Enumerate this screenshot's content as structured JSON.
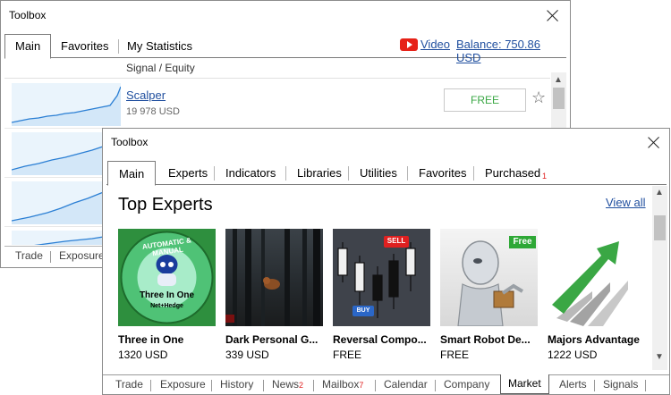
{
  "back_window": {
    "title": "Toolbox",
    "tabs": [
      "Main",
      "Favorites",
      "My Statistics"
    ],
    "video_label": "Video",
    "balance_label": "Balance: 750.86 USD",
    "column_header": "Signal / Equity",
    "signal": {
      "name": "Scalper",
      "amount": "19 978 USD",
      "action_label": "FREE"
    },
    "bottom_tabs": [
      "Trade",
      "Exposure"
    ]
  },
  "front_window": {
    "title": "Toolbox",
    "tabs": [
      {
        "label": "Main"
      },
      {
        "label": "Experts"
      },
      {
        "label": "Indicators"
      },
      {
        "label": "Libraries"
      },
      {
        "label": "Utilities"
      },
      {
        "label": "Favorites"
      },
      {
        "label": "Purchased",
        "badge": "1"
      }
    ],
    "section_title": "Top Experts",
    "view_all_label": "View all",
    "products": [
      {
        "name": "Three in One",
        "price": "1320 USD",
        "image_text": [
          "AUTOMATIC & MANUAL",
          "Three In One",
          "Net+Hedge"
        ]
      },
      {
        "name": "Dark Personal G...",
        "price": "339 USD"
      },
      {
        "name": "Reversal Compo...",
        "price": "FREE",
        "image_text": [
          "SELL",
          "BUY"
        ]
      },
      {
        "name": "Smart Robot De...",
        "price": "FREE",
        "image_text": [
          "Free"
        ]
      },
      {
        "name": "Majors Advantage",
        "price": "1222 USD"
      }
    ],
    "bottom_tabs": [
      {
        "label": "Trade"
      },
      {
        "label": "Exposure"
      },
      {
        "label": "History"
      },
      {
        "label": "News",
        "sub": "2"
      },
      {
        "label": "Mailbox",
        "sub": "7"
      },
      {
        "label": "Calendar"
      },
      {
        "label": "Company"
      },
      {
        "label": "Market",
        "active": true
      },
      {
        "label": "Alerts"
      },
      {
        "label": "Signals"
      }
    ]
  },
  "colors": {
    "link": "#1f4e9e",
    "free_green": "#3aa744",
    "badge_red": "#e02020",
    "chart_blue": "#2b7fd4"
  }
}
